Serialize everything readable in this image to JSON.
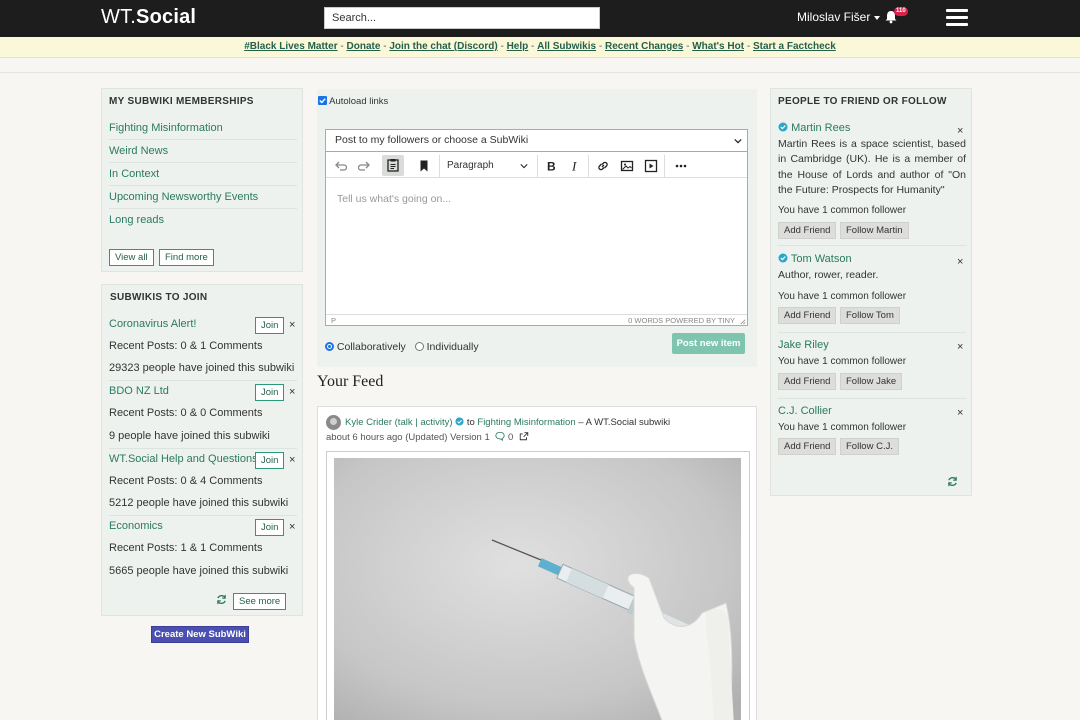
{
  "header": {
    "logo_prefix": "WT.",
    "logo_brand": "Social",
    "search_placeholder": "Search...",
    "user_name": "Miloslav Fišer",
    "notification_count": "110"
  },
  "announcement": {
    "links": [
      "#Black Lives Matter",
      "Donate",
      "Join the chat (Discord)",
      "Help",
      "All Subwikis",
      "Recent Changes",
      "What's Hot",
      "Start a Factcheck"
    ],
    "separator": "-"
  },
  "memberships": {
    "title": "MY SUBWIKI MEMBERSHIPS",
    "items": [
      "Fighting Misinformation",
      "Weird News",
      "In Context",
      "Upcoming Newsworthy Events",
      "Long reads"
    ],
    "view_all": "View all",
    "find_more": "Find more"
  },
  "subwikis_to_join": {
    "title": "SUBWIKIS TO JOIN",
    "join_label": "Join",
    "close_glyph": "×",
    "see_more": "See more",
    "items": [
      {
        "name": "Coronavirus Alert!",
        "posts": "Recent Posts: 0 & 1 Comments",
        "members": "29323 people have joined this subwiki"
      },
      {
        "name": "BDO NZ Ltd",
        "posts": "Recent Posts: 0 & 0 Comments",
        "members": "9 people have joined this subwiki"
      },
      {
        "name": "WT.Social Help and Questions",
        "posts": "Recent Posts: 0 & 4 Comments",
        "members": "5212 people have joined this subwiki"
      },
      {
        "name": "Economics",
        "posts": "Recent Posts: 1 & 1 Comments",
        "members": "5665 people have joined this subwiki"
      }
    ]
  },
  "create_subwiki": "Create New SubWiki",
  "composer": {
    "autoload_label": "Autoload links",
    "target_select": "Post to my followers or choose a SubWiki",
    "format_select": "Paragraph",
    "placeholder": "Tell us what's going on...",
    "status_left": "P",
    "status_right": "0 WORDS  POWERED BY TINY",
    "option_collab": "Collaboratively",
    "option_indiv": "Individually",
    "post_button": "Post new item"
  },
  "feed": {
    "title": "Your Feed",
    "post": {
      "author": "Kyle Crider",
      "author_links": "(talk | activity)",
      "to_text": "to",
      "subwiki": "Fighting Misinformation",
      "subwiki_suffix": "– A WT.Social subwiki",
      "meta": "about 6 hours ago (Updated) Version 1",
      "comment_count": "0"
    }
  },
  "people": {
    "title": "PEOPLE TO FRIEND OR FOLLOW",
    "add_friend": "Add Friend",
    "close_glyph": "×",
    "items": [
      {
        "name": "Martin Rees",
        "verified": true,
        "bio": "Martin Rees is a space scientist,  based in Cambridge (UK). He  is a member  of the House  of Lords and author of  \"On the Future: Prospects for Humanity\"",
        "common": "You have 1 common follower",
        "follow": "Follow Martin"
      },
      {
        "name": "Tom Watson",
        "verified": true,
        "bio": "Author, rower, reader.",
        "common": "You have 1 common follower",
        "follow": "Follow Tom"
      },
      {
        "name": "Jake Riley",
        "verified": false,
        "bio": "",
        "common": "You have 1 common follower",
        "follow": "Follow Jake"
      },
      {
        "name": "C.J. Collier",
        "verified": false,
        "bio": "",
        "common": "You have 1 common follower",
        "follow": "Follow C.J."
      }
    ]
  },
  "colors": {
    "accent": "#2a7a61",
    "topbar": "#1d1d1d",
    "announce_bg": "#fbf8d9",
    "panel_bg": "#eef2ee",
    "post_button": "#7fc4ae",
    "create_button": "#4a4fb1",
    "badge": "#d9214a",
    "verified": "#2aa6c9"
  }
}
